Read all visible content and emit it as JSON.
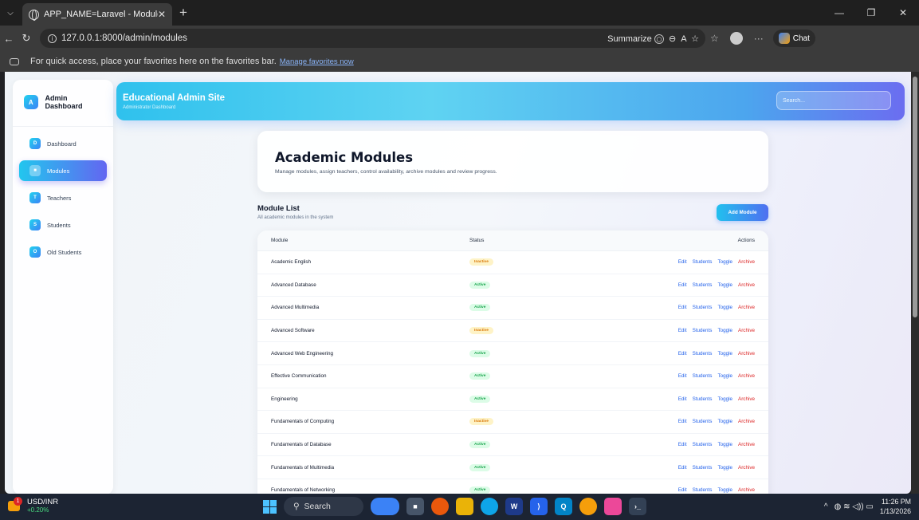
{
  "browser": {
    "tab_title": "APP_NAME=Laravel - Modules",
    "tab_close": "✕",
    "new_tab": "+",
    "url": "127.0.0.1:8000/admin/modules",
    "summarize_label": "Summarize",
    "chat_label": "Chat",
    "favorites_text": "For quick access, place your favorites here on the favorites bar.",
    "favorites_link": "Manage favorites now"
  },
  "sidebar": {
    "logo_letter": "A",
    "title": "Admin Dashboard",
    "items": [
      {
        "letter": "D",
        "label": "Dashboard",
        "active": false
      },
      {
        "letter": "■",
        "label": "Modules",
        "active": true
      },
      {
        "letter": "T",
        "label": "Teachers",
        "active": false
      },
      {
        "letter": "S",
        "label": "Students",
        "active": false
      },
      {
        "letter": "O",
        "label": "Old Students",
        "active": false
      }
    ]
  },
  "header": {
    "title": "Educational Admin Site",
    "subtitle": "Administrator Dashboard",
    "search_placeholder": "Search..."
  },
  "hero": {
    "title": "Academic Modules",
    "description": "Manage modules, assign teachers, control availability, archive modules and review progress."
  },
  "module_list": {
    "title": "Module List",
    "subtitle": "All academic modules in the system",
    "add_button": "Add Module",
    "columns": {
      "module": "Module",
      "status": "Status",
      "actions": "Actions"
    },
    "action_labels": {
      "edit": "Edit",
      "students": "Students",
      "toggle": "Toggle",
      "archive": "Archive"
    },
    "rows": [
      {
        "name": "Academic English",
        "status": "Inactive"
      },
      {
        "name": "Advanced Database",
        "status": "Active"
      },
      {
        "name": "Advanced Multimedia",
        "status": "Active"
      },
      {
        "name": "Advanced Software",
        "status": "Inactive"
      },
      {
        "name": "Advanced Web Engineering",
        "status": "Active"
      },
      {
        "name": "Effective Communication",
        "status": "Active"
      },
      {
        "name": "Engineering",
        "status": "Active"
      },
      {
        "name": "Fundamentals of Computing",
        "status": "Inactive"
      },
      {
        "name": "Fundamentals of Database",
        "status": "Active"
      },
      {
        "name": "Fundamentals of Multimedia",
        "status": "Active"
      },
      {
        "name": "Fundamentals of Networking",
        "status": "Active"
      }
    ]
  },
  "taskbar": {
    "ticker_name": "USD/INR",
    "ticker_change": "+0.20%",
    "ticker_badge": "1",
    "search_label": "Search",
    "time": "11:26 PM",
    "date": "1/13/2026"
  },
  "colors": {
    "accent_cyan": "#22c0ee",
    "accent_indigo": "#6366f1",
    "active_status": "#16a34a",
    "inactive_status": "#d97706",
    "archive_red": "#dc2626"
  }
}
